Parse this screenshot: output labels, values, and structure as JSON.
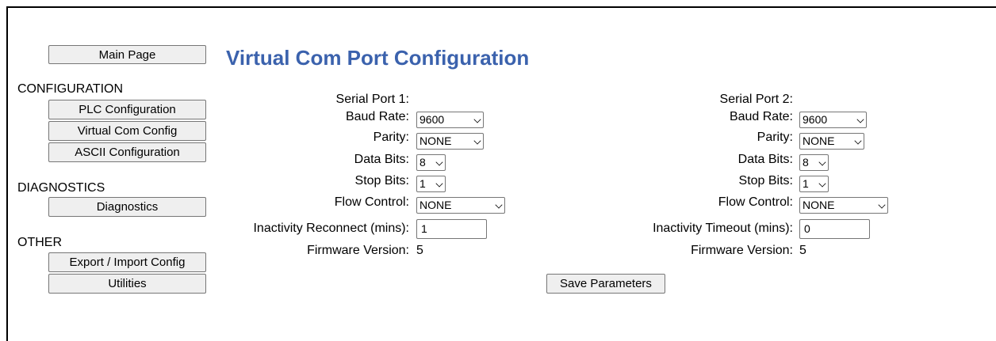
{
  "nav": {
    "main_page": "Main Page",
    "sections": {
      "configuration": "CONFIGURATION",
      "diagnostics": "DIAGNOSTICS",
      "other": "OTHER"
    },
    "items": {
      "plc_configuration": "PLC Configuration",
      "virtual_com_config": "Virtual Com Config",
      "ascii_configuration": "ASCII Configuration",
      "diagnostics": "Diagnostics",
      "export_import": "Export / Import Config",
      "utilities": "Utilities"
    }
  },
  "page": {
    "title": "Virtual Com Port Configuration"
  },
  "port1": {
    "heading": "Serial Port 1:",
    "baud_label": "Baud Rate:",
    "baud_value": "9600",
    "parity_label": "Parity:",
    "parity_value": "NONE",
    "data_bits_label": "Data Bits:",
    "data_bits_value": "8",
    "stop_bits_label": "Stop Bits:",
    "stop_bits_value": "1",
    "flow_label": "Flow Control:",
    "flow_value": "NONE",
    "inactivity_label": "Inactivity Reconnect (mins):",
    "inactivity_value": "1",
    "firmware_label": "Firmware Version:",
    "firmware_value": "5"
  },
  "port2": {
    "heading": "Serial Port 2:",
    "baud_label": "Baud Rate:",
    "baud_value": "9600",
    "parity_label": "Parity:",
    "parity_value": "NONE",
    "data_bits_label": "Data Bits:",
    "data_bits_value": "8",
    "stop_bits_label": "Stop Bits:",
    "stop_bits_value": "1",
    "flow_label": "Flow Control:",
    "flow_value": "NONE",
    "inactivity_label": "Inactivity Timeout (mins):",
    "inactivity_value": "0",
    "firmware_label": "Firmware Version:",
    "firmware_value": "5"
  },
  "actions": {
    "save": "Save Parameters"
  },
  "colors": {
    "title": "#3b62ad",
    "button_bg": "#efefef",
    "border": "#767676"
  }
}
